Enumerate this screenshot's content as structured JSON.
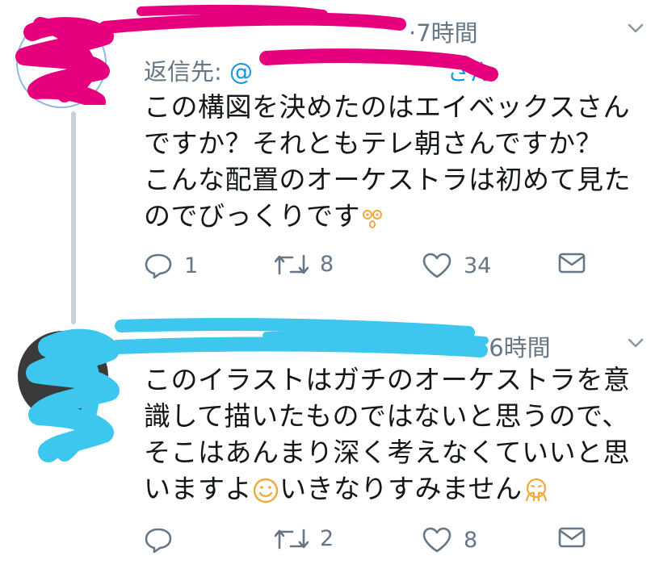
{
  "tweets": [
    {
      "time": "·7時間",
      "reply_label": "返信先:",
      "reply_handle": "@",
      "reply_suffix": "さん",
      "lines": [
        "この構図を決めたのはエイベックスさん",
        "ですか？それともテレ朝さんですか？",
        "こんな配置のオーケストラは初めて見た",
        "のでびっくりです"
      ],
      "counts": {
        "replies": "1",
        "retweets": "8",
        "likes": "34"
      }
    },
    {
      "time": "·6時間",
      "lines": [
        "このイラストはガチのオーケストラを意",
        "識して描いたものではないと思うので、",
        "そこはあんまり深く考えなくていいと思",
        "いますよ",
        "いきなりすみません"
      ],
      "counts": {
        "replies": "",
        "retweets": "2",
        "likes": "8"
      }
    }
  ],
  "icons": [
    "chevron-down-icon",
    "reply-icon",
    "retweet-icon",
    "heart-icon",
    "mail-icon",
    "smile-emoji-icon",
    "surprised-emoji-icon",
    "facepalm-emoji-icon"
  ],
  "colors": {
    "text": "#14171a",
    "muted": "#657786",
    "link": "#1b95e0",
    "redact_pink": "#e6007e",
    "redact_cyan": "#3dc7ef"
  }
}
